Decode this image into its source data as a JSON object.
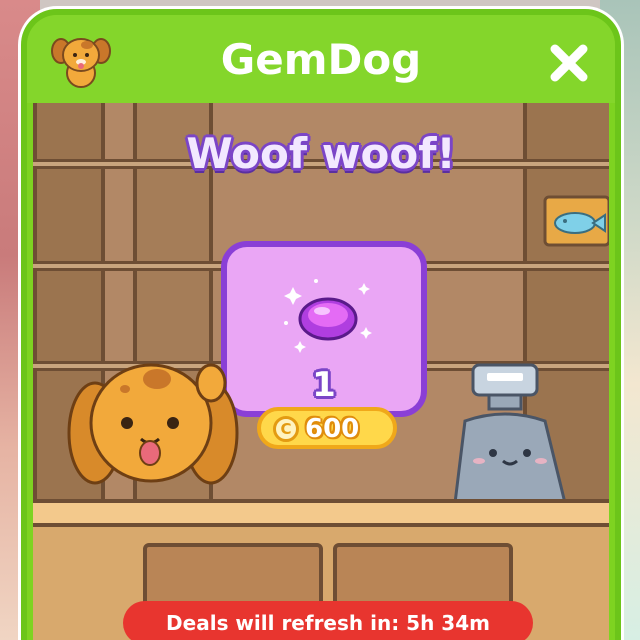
{
  "header": {
    "title": "GemDog",
    "avatar_icon": "dog-face-icon",
    "close_icon": "close-icon"
  },
  "greeting": "Woof woof!",
  "item": {
    "icon": "purple-gem-icon",
    "quantity": "1",
    "price": "600",
    "currency_icon": "coin-icon",
    "currency_symbol": "C"
  },
  "footer": {
    "refresh_text": "Deals will refresh in: 5h 34m"
  },
  "colors": {
    "header_green": "#84d62b",
    "card_purple": "#eaa6f5",
    "card_border": "#8a3fd6",
    "price_yellow": "#ffd84a",
    "banner_red": "#e8352f"
  }
}
